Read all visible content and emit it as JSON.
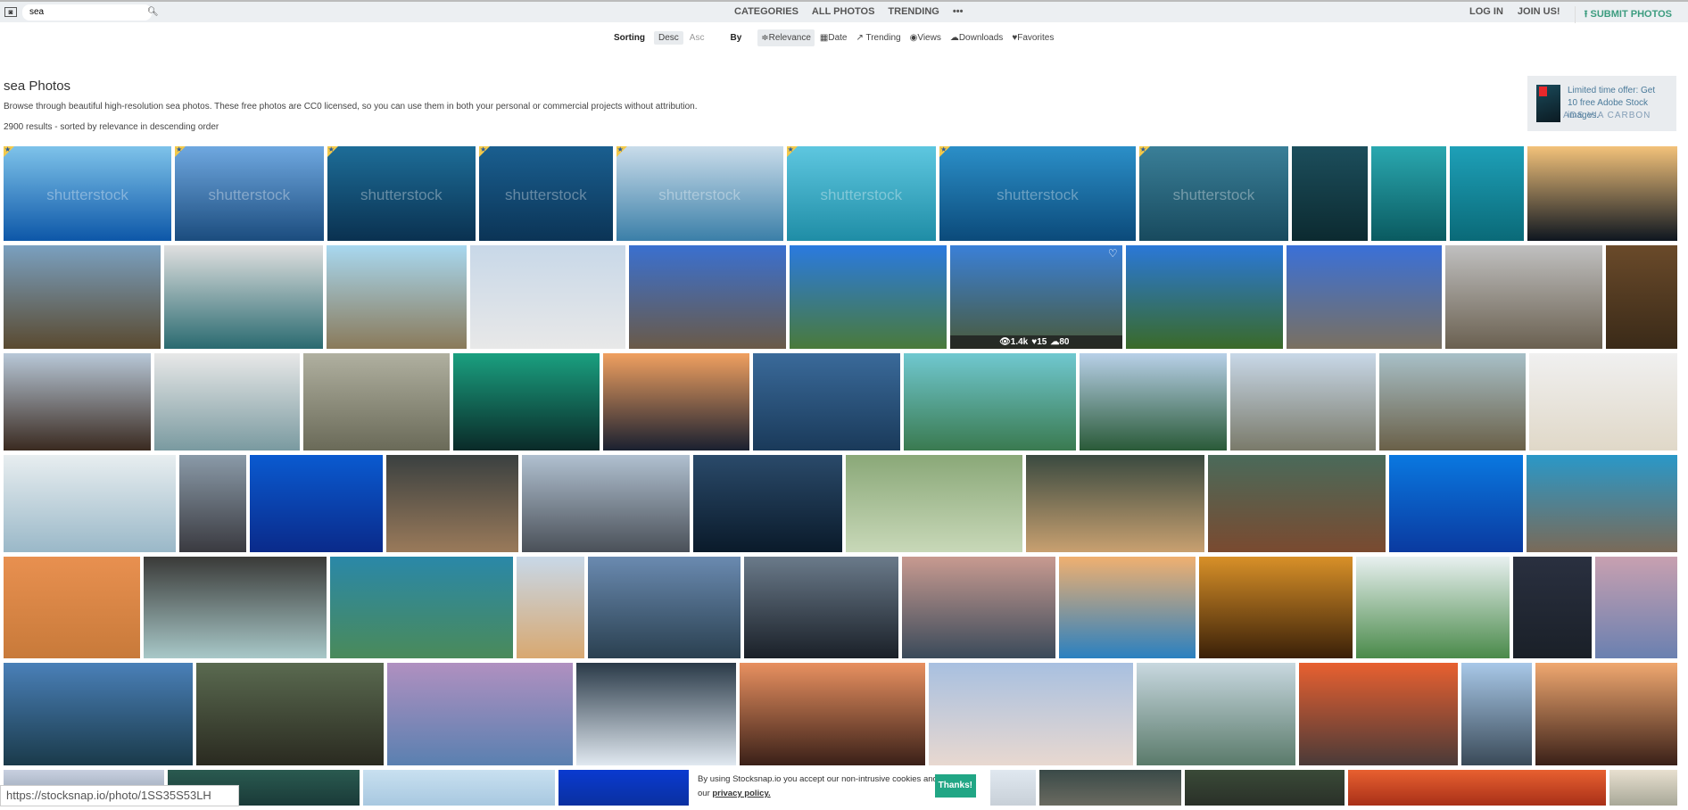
{
  "header": {
    "search_value": "sea",
    "nav": [
      "CATEGORIES",
      "ALL PHOTOS",
      "TRENDING",
      "•••"
    ],
    "login": "LOG IN",
    "join": "JOIN US!",
    "submit": "SUBMIT PHOTOS"
  },
  "sorting": {
    "label": "Sorting",
    "desc": "Desc",
    "asc": "Asc",
    "by": "By",
    "options": [
      {
        "icon": "≑",
        "label": "Relevance"
      },
      {
        "icon": "▦",
        "label": "Date"
      },
      {
        "icon": "↗",
        "label": " Trending"
      },
      {
        "icon": "◉",
        "label": "Views"
      },
      {
        "icon": "☁",
        "label": "Downloads"
      },
      {
        "icon": "♥",
        "label": "Favorites"
      }
    ]
  },
  "page": {
    "title": "sea Photos",
    "description": "Browse through beautiful high-resolution sea photos. These free photos are CC0 licensed, so you can use them in both your personal or commercial projects without attribution.",
    "results": "2900 results - sorted by relevance in descending order"
  },
  "ad": {
    "text": "Limited time offer: Get 10 free Adobe Stock images.",
    "via": "ADS VIA CARBON"
  },
  "watermark": "shutterstock",
  "hover_stats": {
    "views": "1.4k",
    "likes": "15",
    "downloads": "80"
  },
  "colors": {
    "accent": "#3c9c7f",
    "cookie_button": "#21a685"
  },
  "rows": [
    [
      [
        "#7ec3ea",
        "#0d57a8",
        1
      ],
      [
        "#6fa8e0",
        "#1b4c7e",
        1
      ],
      [
        "#1d6d98",
        "#0a3150",
        1
      ],
      [
        "#1a5f90",
        "#0b3456",
        1
      ],
      [
        "#c9dcea",
        "#3b7fa8",
        1
      ],
      [
        "#5ec7e0",
        "#1f8da6",
        1
      ],
      [
        "#2b8fc8",
        "#0b4a7a",
        1
      ],
      [
        "#3a7f98",
        "#184a5e",
        1
      ],
      [
        "#1c4e5c",
        "#0c2a30",
        0
      ],
      [
        "#2aa8b0",
        "#0a5a60",
        0
      ],
      [
        "#1ea0b8",
        "#0a6a78",
        0
      ],
      [
        "#f3c27a",
        "#0e1620",
        0
      ]
    ],
    [
      [
        "#7aa0c0",
        "#5a4a30",
        0
      ],
      [
        "#e0e0e0",
        "#2a6a70",
        0
      ],
      [
        "#a8d8f0",
        "#8a7a5a",
        0
      ],
      [
        "#c8d8e8",
        "#e8e8e8",
        0
      ],
      [
        "#3a70d0",
        "#6a5a48",
        0
      ],
      [
        "#2a7ae0",
        "#4a7a3a",
        0
      ],
      [
        "#3a80d8",
        "#4a5a3a",
        0
      ],
      [
        "#2a78d8",
        "#3a6a28",
        0
      ],
      [
        "#3a70d8",
        "#7a7060",
        0
      ],
      [
        "#c0c0c0",
        "#6a6050",
        0
      ],
      [
        "#6a4a2a",
        "#3a2a18",
        0
      ]
    ],
    [
      [
        "#b8c8d8",
        "#3a2a20",
        0
      ],
      [
        "#e8e8e8",
        "#7a9aa0",
        0
      ],
      [
        "#b0b0a0",
        "#6a6a58",
        0
      ],
      [
        "#1aa080",
        "#0a2a28",
        0
      ],
      [
        "#f0a060",
        "#1a2030",
        0
      ],
      [
        "#3a6a9a",
        "#1a3a5a",
        0
      ],
      [
        "#70c8d0",
        "#3a7a50",
        0
      ],
      [
        "#b8d0e8",
        "#2a5a38",
        0
      ],
      [
        "#c8d8e8",
        "#7a7a6a",
        0
      ],
      [
        "#a8c0c8",
        "#6a6048",
        0
      ],
      [
        "#f0f0f0",
        "#e0d8c8",
        0
      ]
    ],
    [
      [
        "#e8eef0",
        "#9ab8c8",
        0
      ],
      [
        "#8a9aa8",
        "#3a3a40",
        0
      ],
      [
        "#0a5ad0",
        "#0a2a8a",
        0
      ],
      [
        "#3a4040",
        "#9a7a5a",
        0
      ],
      [
        "#b0c0d0",
        "#4a5058",
        0
      ],
      [
        "#2a4a6a",
        "#0a1a2a",
        0
      ],
      [
        "#8aa878",
        "#c8d8b8",
        0
      ],
      [
        "#3a4a40",
        "#c8a070",
        0
      ],
      [
        "#4a6a5a",
        "#7a4a30",
        0
      ],
      [
        "#0a78e0",
        "#0a3aa0",
        0
      ],
      [
        "#2a98c8",
        "#7a6a58",
        0
      ]
    ],
    [
      [
        "#e89050",
        "#c87a3a",
        0
      ],
      [
        "#3a3a38",
        "#a8c8c8",
        0
      ],
      [
        "#2a88a8",
        "#4a8a5a",
        0
      ],
      [
        "#c8d8e8",
        "#d8a870",
        0
      ],
      [
        "#6a8ab0",
        "#2a4050",
        0
      ],
      [
        "#6a7a8a",
        "#1a2028",
        0
      ],
      [
        "#c89a90",
        "#3a4a5a",
        0
      ],
      [
        "#f0b070",
        "#2a80c0",
        0
      ],
      [
        "#d89028",
        "#3a2008",
        0
      ],
      [
        "#e8f0f0",
        "#4a8a4a",
        0
      ],
      [
        "#2a3040",
        "#1a2028",
        0
      ],
      [
        "#c8a0b0",
        "#6a80b0",
        0
      ]
    ],
    [
      [
        "#4a80b8",
        "#1a3a4a",
        0
      ],
      [
        "#5a6a50",
        "#2a2a20",
        0
      ],
      [
        "#b090c0",
        "#5a80b0",
        0
      ],
      [
        "#2a3a48",
        "#e0e8f0",
        0
      ],
      [
        "#e89060",
        "#3a2018",
        0
      ],
      [
        "#a8c0e0",
        "#e8d8d0",
        0
      ],
      [
        "#c8d8e0",
        "#5a7a6a",
        0
      ],
      [
        "#e86030",
        "#4a3a38",
        0
      ],
      [
        "#a8c8e8",
        "#3a4a58",
        0
      ],
      [
        "#f0a870",
        "#3a2018",
        0
      ]
    ],
    [
      [
        "#c8d0e0",
        "#8a98a8",
        0
      ],
      [
        "#2a5a50",
        "#1a3a38",
        0
      ],
      [
        "#c8e0f0",
        "#a8c8e0",
        0
      ],
      [
        "#0a3ad0",
        "#0a30a0",
        0
      ],
      [
        "#c8b8a0",
        "#8a7a68",
        0
      ],
      [
        "#e0e8f0",
        "#c8d0d8",
        0
      ],
      [
        "#3a4a48",
        "#6a6a60",
        0
      ],
      [
        "#3a4a38",
        "#2a3028",
        0
      ],
      [
        "#e86030",
        "#a83018",
        0
      ],
      [
        "#e8e0d0",
        "#a8a898",
        0
      ]
    ]
  ],
  "status_url": "https://stocksnap.io/photo/1SS35S53LH",
  "cookie": {
    "text": "By using Stocksnap.io you accept our non-intrusive cookies and agree to our",
    "link": "privacy policy.",
    "button": "Thanks!"
  }
}
